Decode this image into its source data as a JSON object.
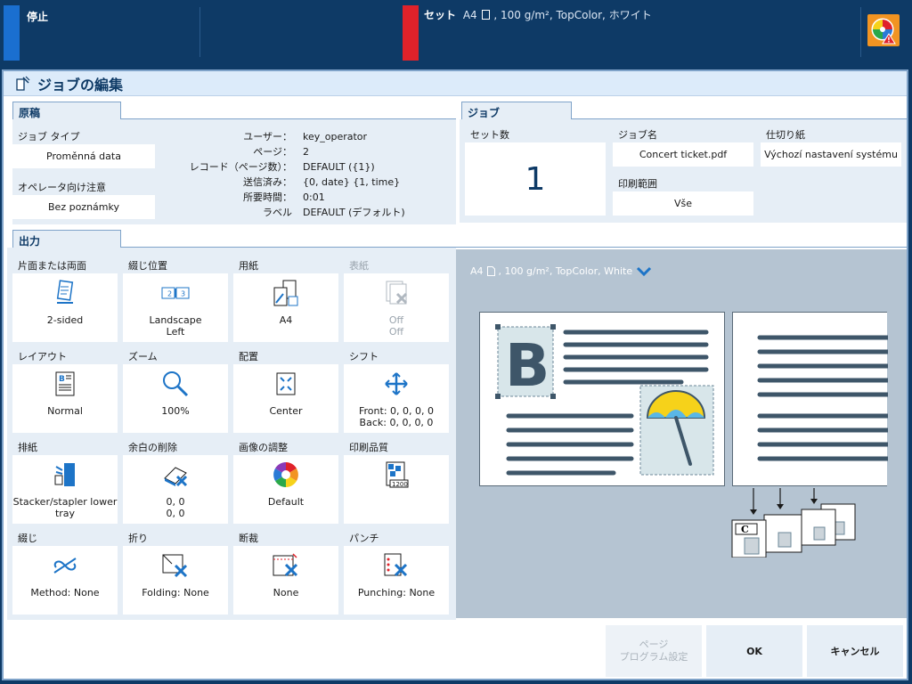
{
  "status": {
    "stop_label": "停止",
    "set_label": "セット",
    "set_size": "A4",
    "set_details": ", 100 g/m², TopColor, ホワイト",
    "warn_icon": "color-warning-icon"
  },
  "window": {
    "title": "ジョブの編集"
  },
  "original": {
    "tab": "原稿",
    "job_type_label": "ジョブ タイプ",
    "job_type_value": "Proměnná data",
    "operator_note_label": "オペレータ向け注意",
    "operator_note_value": "Bez poznámky",
    "info": [
      {
        "k": "ユーザー：",
        "v": "key_operator"
      },
      {
        "k": "ページ：",
        "v": "2"
      },
      {
        "k": "レコード（ページ数）：",
        "v": "DEFAULT ({1})"
      },
      {
        "k": "送信済み：",
        "v": "{0, date} {1, time}"
      },
      {
        "k": "所要時間：",
        "v": "0:01"
      },
      {
        "k": "ラベル",
        "v": "DEFAULT (デフォルト)"
      }
    ]
  },
  "job": {
    "tab": "ジョブ",
    "sets_label": "セット数",
    "sets_value": "1",
    "name_label": "ジョブ名",
    "name_value": "Concert ticket.pdf",
    "range_label": "印刷範囲",
    "range_value": "Vše",
    "separator_label": "仕切り紙",
    "separator_value": "Výchozí nastavení systému"
  },
  "output": {
    "tab": "出力",
    "tiles": [
      {
        "head": "片面または両面",
        "l1": "2-sided",
        "l2": "",
        "icon": "duplex-icon"
      },
      {
        "head": "綴じ位置",
        "l1": "Landscape",
        "l2": "Left",
        "icon": "binding-edge-icon"
      },
      {
        "head": "用紙",
        "l1": "A4",
        "l2": "",
        "icon": "media-icon"
      },
      {
        "head": "表紙",
        "l1": "Off",
        "l2": "Off",
        "icon": "cover-icon"
      },
      {
        "head": "レイアウト",
        "l1": "Normal",
        "l2": "",
        "icon": "layout-icon"
      },
      {
        "head": "ズーム",
        "l1": "100%",
        "l2": "",
        "icon": "zoom-icon"
      },
      {
        "head": "配置",
        "l1": "Center",
        "l2": "",
        "icon": "alignment-icon"
      },
      {
        "head": "シフト",
        "l1": "Front: 0, 0, 0, 0",
        "l2": "Back: 0, 0, 0, 0",
        "icon": "shift-icon"
      },
      {
        "head": "排紙",
        "l1": "Stacker/stapler lower",
        "l2": "tray",
        "icon": "output-tray-icon"
      },
      {
        "head": "余白の削除",
        "l1": "0, 0",
        "l2": "0, 0",
        "icon": "edge-erase-icon"
      },
      {
        "head": "画像の調整",
        "l1": "Default",
        "l2": "",
        "icon": "color-wheel-icon"
      },
      {
        "head": "印刷品質",
        "l1": "",
        "l2": "",
        "icon": "print-quality-icon"
      },
      {
        "head": "綴じ",
        "l1": "Method: None",
        "l2": "",
        "icon": "staple-icon"
      },
      {
        "head": "折り",
        "l1": "Folding: None",
        "l2": "",
        "icon": "folding-icon"
      },
      {
        "head": "断裁",
        "l1": "None",
        "l2": "",
        "icon": "trimming-icon"
      },
      {
        "head": "パンチ",
        "l1": "Punching: None",
        "l2": "",
        "icon": "punching-icon"
      }
    ],
    "quality_badge": "1200"
  },
  "preview": {
    "media_size": "A4",
    "media_details": ", 100 g/m², TopColor, White",
    "page_letter": "B",
    "stack_letter": "C"
  },
  "buttons": {
    "page_program_l1": "ページ",
    "page_program_l2": "プログラム設定",
    "ok": "OK",
    "cancel": "キャンセル"
  },
  "colors": {
    "accent_blue": "#1a6fd0",
    "accent_red": "#e0222a",
    "icon_blue": "#1d74c7",
    "navy": "#0e3a66"
  }
}
